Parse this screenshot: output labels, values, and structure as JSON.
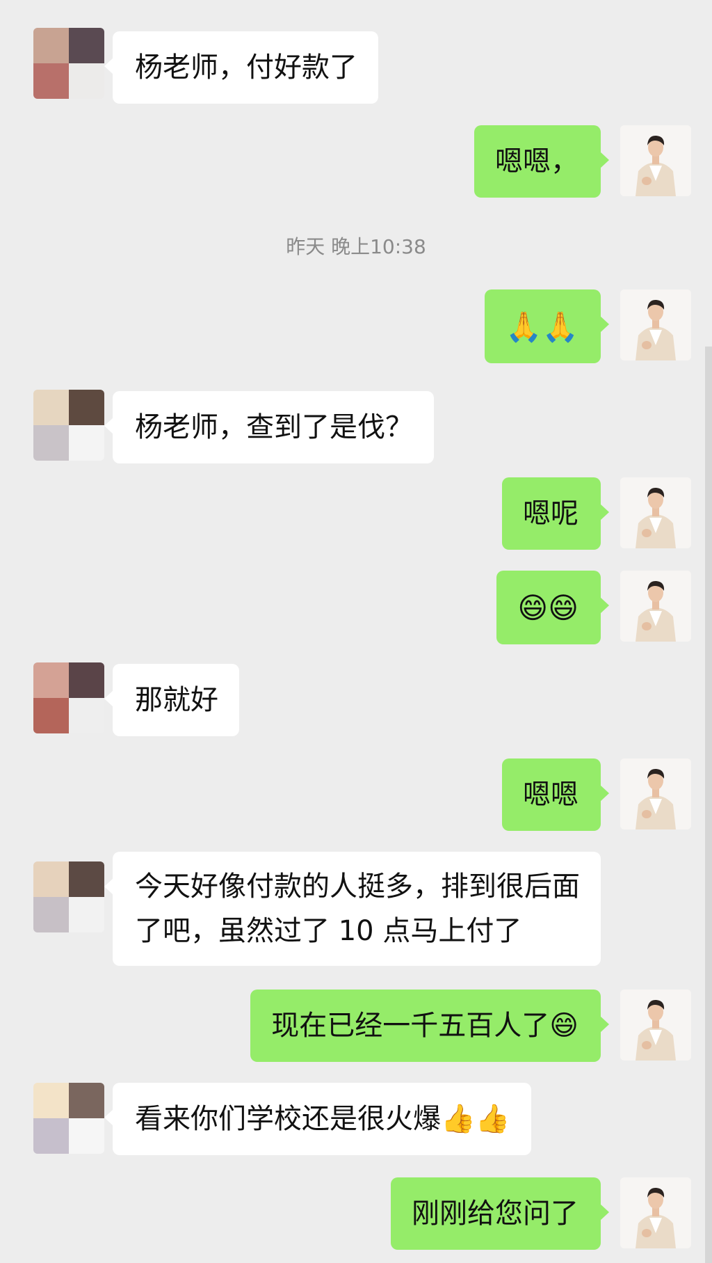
{
  "chat": {
    "timestamp": "昨天 晚上10:38",
    "messages": [
      {
        "side": "other",
        "text": "杨老师，付好款了",
        "avatar": "mosaic-a"
      },
      {
        "side": "self",
        "text": "嗯嗯，",
        "avatar": "teacher-photo"
      },
      {
        "side": "self",
        "text": "🙏🙏",
        "avatar": "teacher-photo"
      },
      {
        "side": "other",
        "text": "杨老师，查到了是伐？",
        "avatar": "mosaic-b"
      },
      {
        "side": "self",
        "text": "嗯呢",
        "avatar": "teacher-photo"
      },
      {
        "side": "self",
        "text": "😄😄",
        "avatar": "teacher-photo"
      },
      {
        "side": "other",
        "text": "那就好",
        "avatar": "mosaic-a"
      },
      {
        "side": "self",
        "text": "嗯嗯",
        "avatar": "teacher-photo"
      },
      {
        "side": "other",
        "text": "今天好像付款的人挺多，排到很后面了吧，虽然过了 10 点马上付了",
        "avatar": "mosaic-b"
      },
      {
        "side": "self",
        "text": "现在已经一千五百人了😄",
        "avatar": "teacher-photo"
      },
      {
        "side": "other",
        "text": "看来你们学校还是很火爆👍👍",
        "avatar": "mosaic-c"
      },
      {
        "side": "self",
        "text": "刚刚给您问了",
        "avatar": "teacher-photo"
      }
    ]
  },
  "colors": {
    "background": "#ededed",
    "self_bubble": "#95ec69",
    "other_bubble": "#ffffff",
    "timestamp_text": "#8a8a8a"
  }
}
